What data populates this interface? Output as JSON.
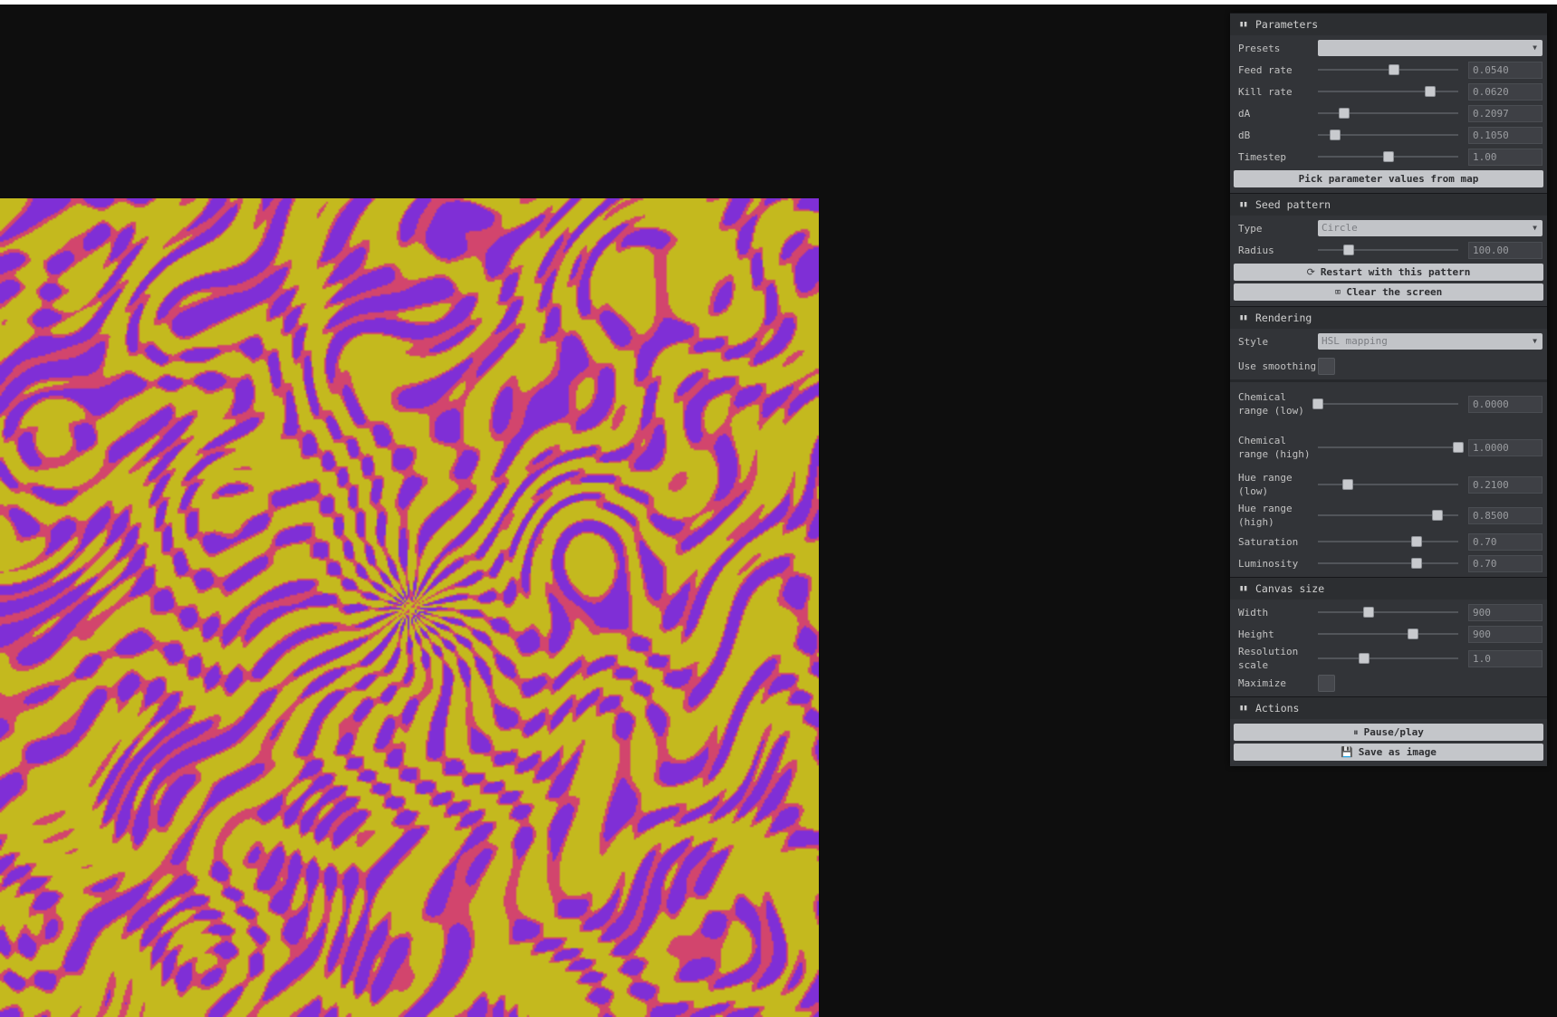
{
  "colors": {
    "background": "#0e0e0e",
    "pattern_base": "#c4b91e",
    "pattern_mid": "#d2456d",
    "pattern_core": "#7f2fd6"
  },
  "parameters": {
    "title": "Parameters",
    "presets_label": "Presets",
    "presets_value": "",
    "feed_label": "Feed rate",
    "feed_value": "0.0540",
    "feed_level": 0.54,
    "kill_label": "Kill rate",
    "kill_value": "0.0620",
    "kill_level": 0.8,
    "dA_label": "dA",
    "dA_value": "0.2097",
    "dA_level": 0.19,
    "dB_label": "dB",
    "dB_value": "0.1050",
    "dB_level": 0.12,
    "timestep_label": "Timestep",
    "timestep_value": "1.00",
    "timestep_level": 0.5,
    "pick_button": "Pick parameter values from map"
  },
  "seed": {
    "title": "Seed pattern",
    "type_label": "Type",
    "type_value": "Circle",
    "radius_label": "Radius",
    "radius_value": "100.00",
    "radius_level": 0.22,
    "restart_button": "Restart with this pattern",
    "clear_button": "Clear the screen"
  },
  "rendering": {
    "title": "Rendering",
    "style_label": "Style",
    "style_value": "HSL mapping",
    "smoothing_label": "Use smoothing",
    "chem_low_label": "Chemical range (low)",
    "chem_low_value": "0.0000",
    "chem_low_level": 0.0,
    "chem_high_label": "Chemical range (high)",
    "chem_high_value": "1.0000",
    "chem_high_level": 1.0,
    "hue_low_label": "Hue range (low)",
    "hue_low_value": "0.2100",
    "hue_low_level": 0.21,
    "hue_high_label": "Hue range (high)",
    "hue_high_value": "0.8500",
    "hue_high_level": 0.85,
    "saturation_label": "Saturation",
    "saturation_value": "0.70",
    "saturation_level": 0.7,
    "luminosity_label": "Luminosity",
    "luminosity_value": "0.70",
    "luminosity_level": 0.7
  },
  "canvas": {
    "title": "Canvas size",
    "width_label": "Width",
    "width_value": "900",
    "width_level": 0.36,
    "height_label": "Height",
    "height_value": "900",
    "height_level": 0.68,
    "resolution_label": "Resolution scale",
    "resolution_value": "1.0",
    "resolution_level": 0.33,
    "maximize_label": "Maximize"
  },
  "actions": {
    "title": "Actions",
    "pause_button": "Pause/play",
    "save_button": "Save as image"
  }
}
